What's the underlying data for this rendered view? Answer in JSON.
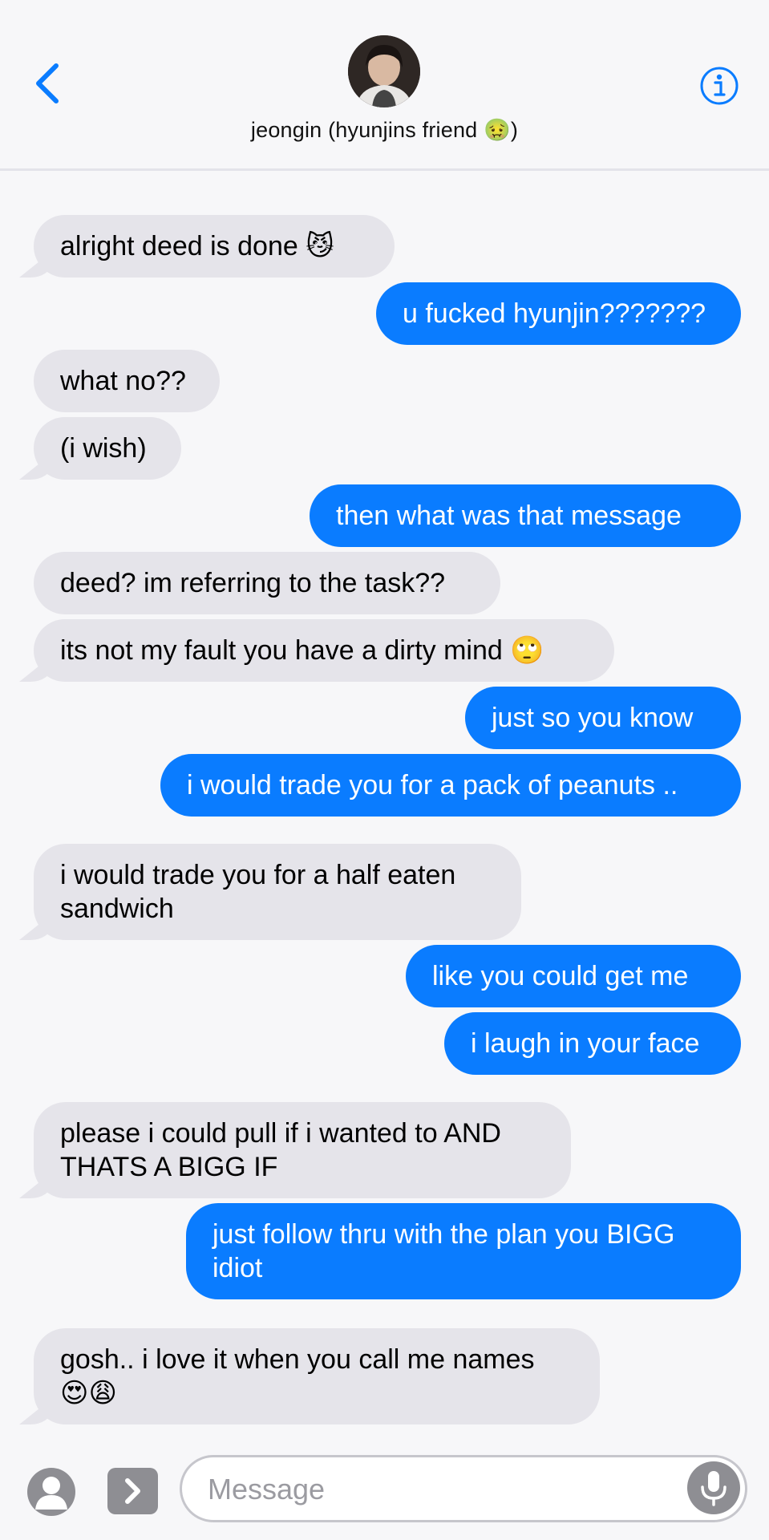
{
  "header": {
    "contact_name": "jeongin (hyunjins friend 🤢)"
  },
  "messages": [
    {
      "dir": "in",
      "lines": [
        "alright deed is done 😼"
      ]
    },
    {
      "dir": "out",
      "lines": [
        "u fucked hyunjin???????"
      ]
    },
    {
      "dir": "in",
      "lines": [
        "what no??"
      ]
    },
    {
      "dir": "in",
      "lines": [
        "(i wish)"
      ]
    },
    {
      "dir": "out",
      "lines": [
        "then what was that message"
      ]
    },
    {
      "dir": "in",
      "lines": [
        "deed? im referring to the task??"
      ]
    },
    {
      "dir": "in",
      "lines": [
        "its not my fault you have a dirty mind 🙄"
      ]
    },
    {
      "dir": "out",
      "lines": [
        "just so you know"
      ]
    },
    {
      "dir": "out",
      "lines": [
        "i would trade you for a pack of peanuts .."
      ]
    },
    {
      "dir": "in",
      "lines": [
        "i would trade you for a half eaten",
        "sandwich"
      ]
    },
    {
      "dir": "out",
      "lines": [
        "like you could get me"
      ]
    },
    {
      "dir": "out",
      "lines": [
        "i laugh in your face"
      ]
    },
    {
      "dir": "in",
      "lines": [
        "please i could pull if i wanted to AND",
        "THATS A BIGG IF"
      ]
    },
    {
      "dir": "out",
      "lines": [
        "just follow thru with the plan you BIGG",
        "idiot"
      ]
    },
    {
      "dir": "in",
      "lines": [
        "gosh.. i love it when you call me names",
        "😍😩"
      ]
    }
  ],
  "composer": {
    "placeholder": "Message"
  },
  "colors": {
    "accent": "#0a7cff",
    "incoming_bubble": "#e5e4ea",
    "background": "#f7f7f9"
  },
  "icons": {
    "back": "chevron-left-icon",
    "info": "info-icon",
    "camera": "person-camera-icon",
    "apps": "chevron-right-icon",
    "mic": "microphone-icon"
  }
}
